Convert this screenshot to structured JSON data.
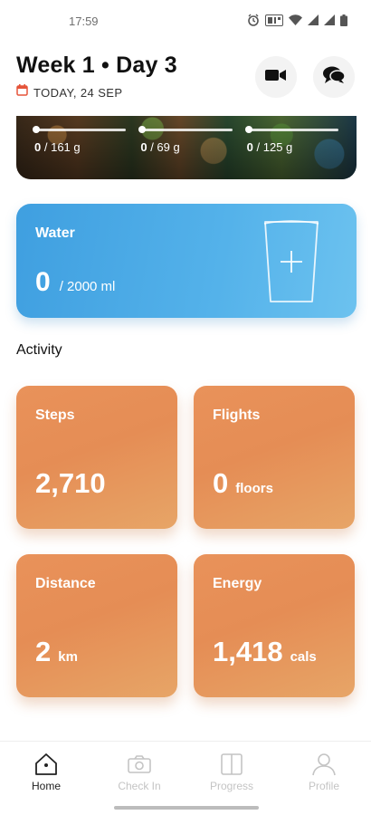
{
  "status_bar": {
    "time": "17:59",
    "icons": [
      "alarm-icon",
      "nfc-icon",
      "wifi-icon",
      "signal-icon",
      "signal-icon",
      "battery-icon"
    ]
  },
  "header": {
    "title": "Week 1 • Day 3",
    "date": "TODAY, 24 SEP",
    "icons": [
      "calendar-icon",
      "video-camera-icon",
      "chat-bubbles-icon"
    ],
    "accent_color": "#e5543a"
  },
  "food_card": {
    "macros": [
      {
        "value": "0",
        "goal": "/ 161 g"
      },
      {
        "value": "0",
        "goal": "/ 69 g"
      },
      {
        "value": "0",
        "goal": "/ 125 g"
      }
    ]
  },
  "water": {
    "label": "Water",
    "value": "0",
    "goal": "/ 2000 ml",
    "color": "#4aa9e6",
    "icon": "glass-plus-icon"
  },
  "activity": {
    "title": "Activity",
    "color": "#e8935a",
    "tiles": [
      {
        "label": "Steps",
        "value": "2,710",
        "unit": ""
      },
      {
        "label": "Flights",
        "value": "0",
        "unit": "floors"
      },
      {
        "label": "Distance",
        "value": "2",
        "unit": "km"
      },
      {
        "label": "Energy",
        "value": "1,418",
        "unit": "cals"
      }
    ]
  },
  "bottom_nav": {
    "items": [
      {
        "label": "Home",
        "icon": "home-icon",
        "active": true
      },
      {
        "label": "Check In",
        "icon": "camera-icon",
        "active": false
      },
      {
        "label": "Progress",
        "icon": "book-icon",
        "active": false
      },
      {
        "label": "Profile",
        "icon": "person-icon",
        "active": false
      }
    ]
  }
}
